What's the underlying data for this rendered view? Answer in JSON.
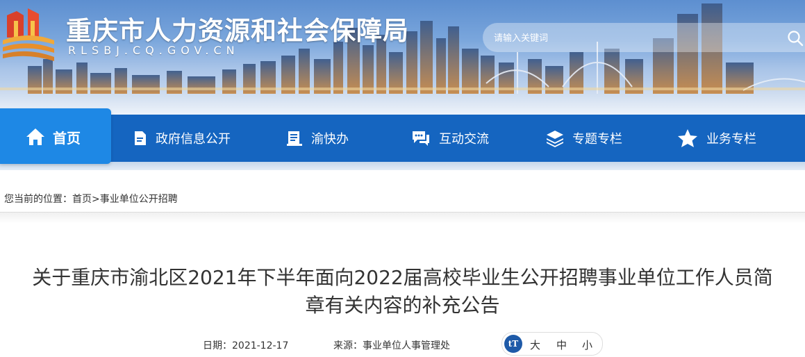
{
  "header": {
    "site_title": "重庆市人力资源和社会保障局",
    "site_domain": "RLSBJ.CQ.GOV.CN",
    "search_placeholder": "请输入关键词"
  },
  "nav": {
    "items": [
      {
        "label": "首页",
        "icon": "home-icon"
      },
      {
        "label": "政府信息公开",
        "icon": "document-icon"
      },
      {
        "label": "渝快办",
        "icon": "clipboard-icon"
      },
      {
        "label": "互动交流",
        "icon": "chat-icon"
      },
      {
        "label": "专题专栏",
        "icon": "layers-icon"
      },
      {
        "label": "业务专栏",
        "icon": "star-icon"
      }
    ]
  },
  "breadcrumb": {
    "prefix": "您当前的位置：",
    "home": "首页",
    "separator": ">",
    "current": "事业单位公开招聘"
  },
  "article": {
    "title_line1": "关于重庆市渝北区2021年下半年面向2022届高校毕业生公开招聘事业单位工作人员简",
    "title_line2": "章有关内容的补充公告",
    "date_label": "日期：2021-12-17",
    "source_label": "来源：事业单位人事管理处",
    "font_size": {
      "icon": "tT",
      "large": "大",
      "medium": "中",
      "small": "小"
    }
  },
  "colors": {
    "nav": "#1565c0",
    "nav_active": "#1e88e5",
    "text": "#333333"
  }
}
